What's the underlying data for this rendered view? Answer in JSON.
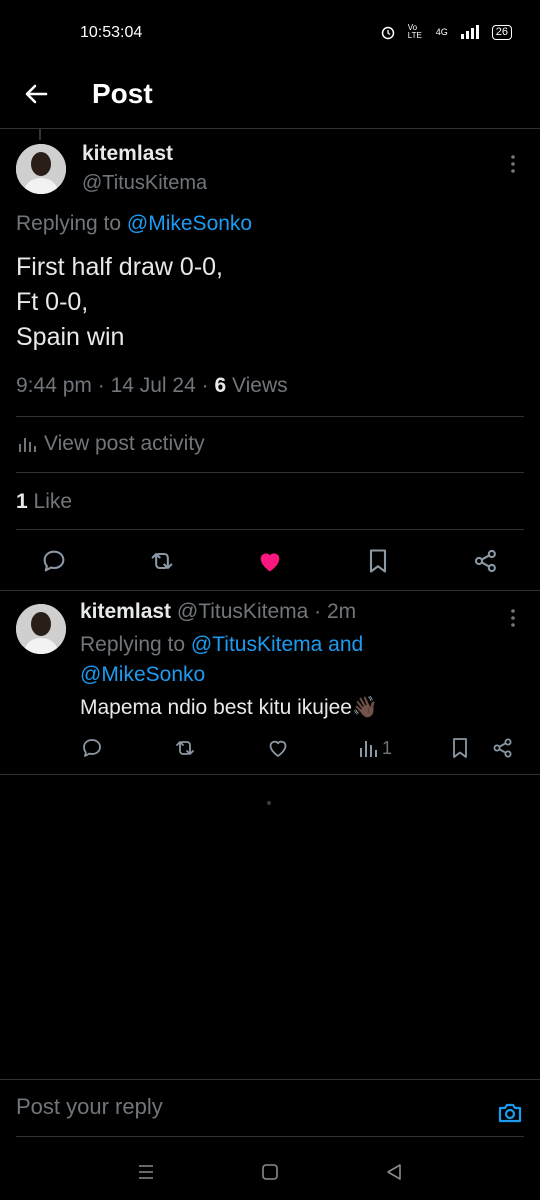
{
  "status_bar": {
    "time": "10:53:04",
    "network_label": "4G",
    "volte_label": "Vo LTE",
    "battery": "26"
  },
  "header": {
    "title": "Post"
  },
  "main_post": {
    "name": "kitemlast",
    "handle": "@TitusKitema",
    "replying_prefix": "Replying to ",
    "replying_to": "@MikeSonko",
    "text": "First half draw 0-0,\nFt 0-0,\nSpain win",
    "time": "9:44 pm",
    "date": "14 Jul 24",
    "views_count": "6",
    "views_label": " Views",
    "activity_label": "View post activity",
    "likes_count": "1",
    "likes_label": " Like"
  },
  "reply_post": {
    "name": "kitemlast",
    "handle": "@TitusKitema",
    "age": "2m",
    "replying_prefix": "Replying to ",
    "replying_to_1": "@TitusKitema",
    "replying_and": " and",
    "replying_to_2": "@MikeSonko",
    "text": "Mapema ndio best kitu ikujee👋🏿",
    "views_count": "1"
  },
  "composer": {
    "placeholder": "Post your reply"
  },
  "colors": {
    "accent": "#1d9bf0",
    "like": "#f91880",
    "muted": "#71767b",
    "background": "#000000"
  },
  "icons": [
    "back-arrow-icon",
    "more-icon",
    "bar-chart-icon",
    "reply-icon",
    "repost-icon",
    "heart-icon",
    "bookmark-icon",
    "share-icon",
    "camera-icon",
    "menu-icon",
    "home-square-icon",
    "back-triangle-icon"
  ]
}
